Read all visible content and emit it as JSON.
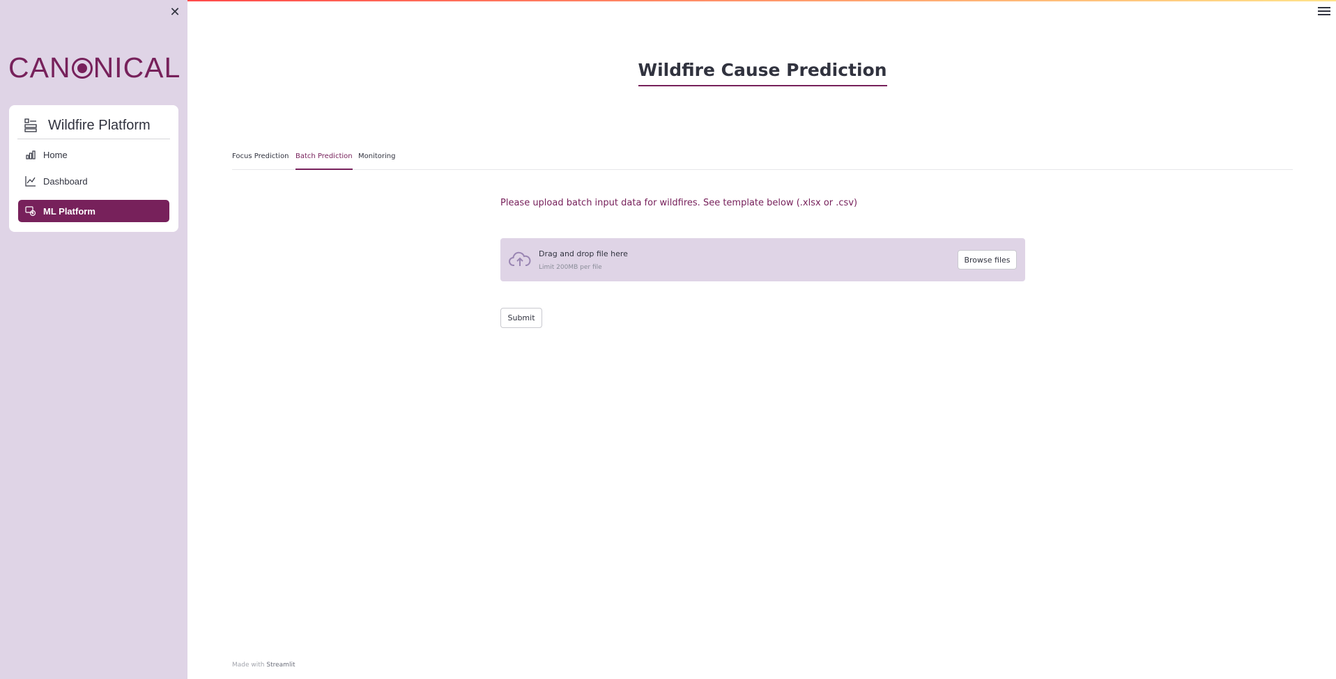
{
  "sidebar": {
    "close_icon": "close-icon",
    "logo_text_before": "CAN",
    "logo_text_after": "NICAL",
    "nav_title": "Wildfire Platform",
    "nav_title_icon": "grid-icon",
    "items": [
      {
        "label": "Home",
        "icon": "bar-chart-icon",
        "active": false
      },
      {
        "label": "Dashboard",
        "icon": "line-chart-icon",
        "active": false
      },
      {
        "label": "ML Platform",
        "icon": "ml-icon",
        "active": true
      }
    ]
  },
  "header": {
    "title": "Wildfire Cause Prediction",
    "menu_icon": "hamburger-icon"
  },
  "tabs": [
    {
      "label": "Focus Prediction",
      "active": false
    },
    {
      "label": "Batch Prediction",
      "active": true
    },
    {
      "label": "Monitoring",
      "active": false
    }
  ],
  "main": {
    "upload_prompt": "Please upload batch input data for wildfires. See template below (.xlsx or .csv)",
    "dropzone": {
      "title": "Drag and drop file here",
      "limit": "Limit 200MB per file",
      "browse_label": "Browse files",
      "icon": "cloud-upload-icon"
    },
    "submit_label": "Submit"
  },
  "footer": {
    "made_with": "Made with",
    "brand": "Streamlit"
  },
  "colors": {
    "accent": "#77215b",
    "sidebar_bg": "#dfd4e6"
  }
}
